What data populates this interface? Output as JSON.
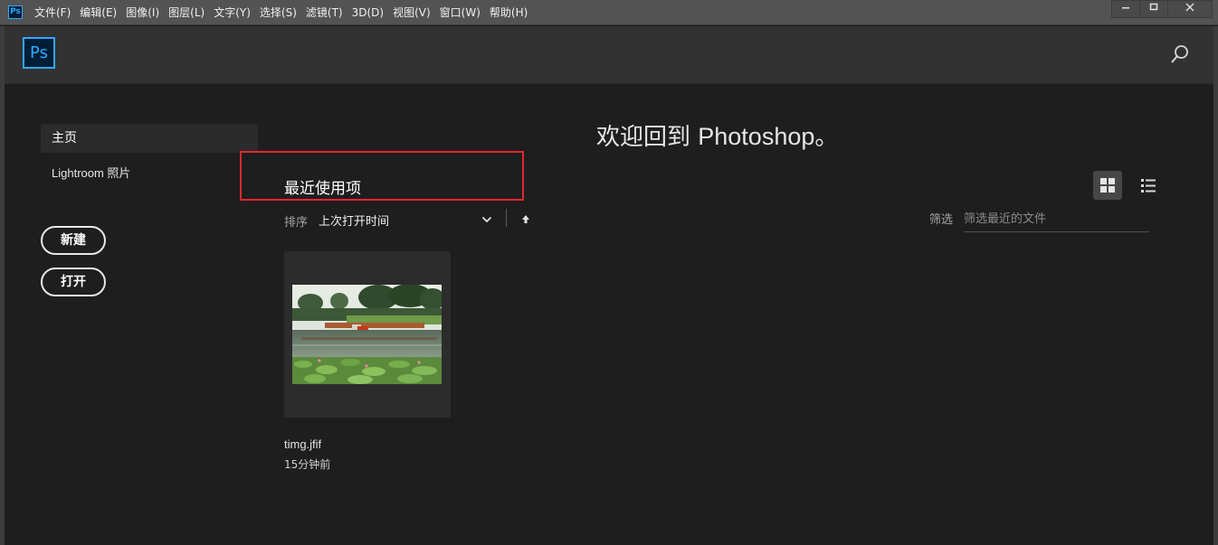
{
  "menubar": {
    "app_icon": "Ps",
    "items": [
      "文件(F)",
      "编辑(E)",
      "图像(I)",
      "图层(L)",
      "文字(Y)",
      "选择(S)",
      "滤镜(T)",
      "3D(D)",
      "视图(V)",
      "窗口(W)",
      "帮助(H)"
    ],
    "window_controls": [
      "minimize-icon",
      "maximize-icon",
      "close-icon"
    ]
  },
  "header": {
    "logo": "Ps",
    "search_icon": "search-icon"
  },
  "sidebar": {
    "items": [
      {
        "label": "主页",
        "selected": true
      },
      {
        "label": "Lightroom 照片",
        "selected": false
      }
    ],
    "new_button": "新建",
    "open_button": "打开"
  },
  "welcome": {
    "prefix": "欢迎回到 ",
    "app": "Photoshop",
    "suffix": "。"
  },
  "recent": {
    "title": "最近使用项",
    "sort_label": "排序",
    "sort_value": "上次打开时间",
    "filter_label": "筛选",
    "filter_placeholder": "筛选最近的文件",
    "view_mode": "grid",
    "files": [
      {
        "name": "timg.jfif",
        "time": "15分钟前"
      }
    ]
  },
  "colors": {
    "accent": "#31a8ff",
    "highlight_frame": "#e0282d",
    "background": "#1e1e1e"
  }
}
